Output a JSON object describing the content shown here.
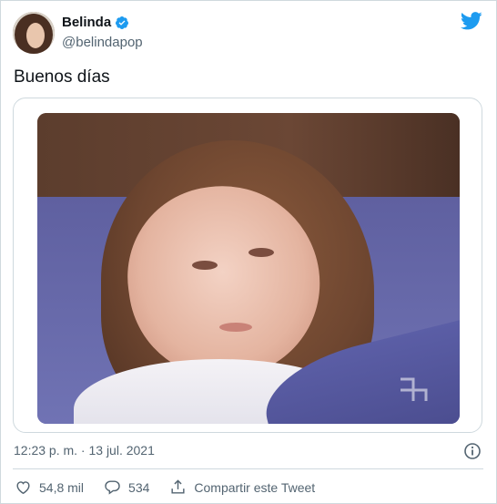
{
  "user": {
    "display_name": "Belinda",
    "handle": "@belindapop",
    "verified": true,
    "avatar": "profile-photo"
  },
  "tweet": {
    "text": "Buenos días",
    "media": "photo-girl-in-bed",
    "timestamp": "12:23 p. m. · 13 jul. 2021"
  },
  "actions": {
    "likes": "54,8 mil",
    "replies": "534",
    "share_label": "Compartir este Tweet"
  },
  "icons": {
    "brand": "twitter-bird-icon",
    "verified": "verified-badge-icon",
    "info": "info-icon",
    "like": "heart-icon",
    "reply": "reply-bubble-icon",
    "share": "share-icon"
  },
  "colors": {
    "twitter_blue": "#1d9bf0",
    "text_primary": "#0f1419",
    "text_secondary": "#536471",
    "border": "#cfd9de"
  }
}
